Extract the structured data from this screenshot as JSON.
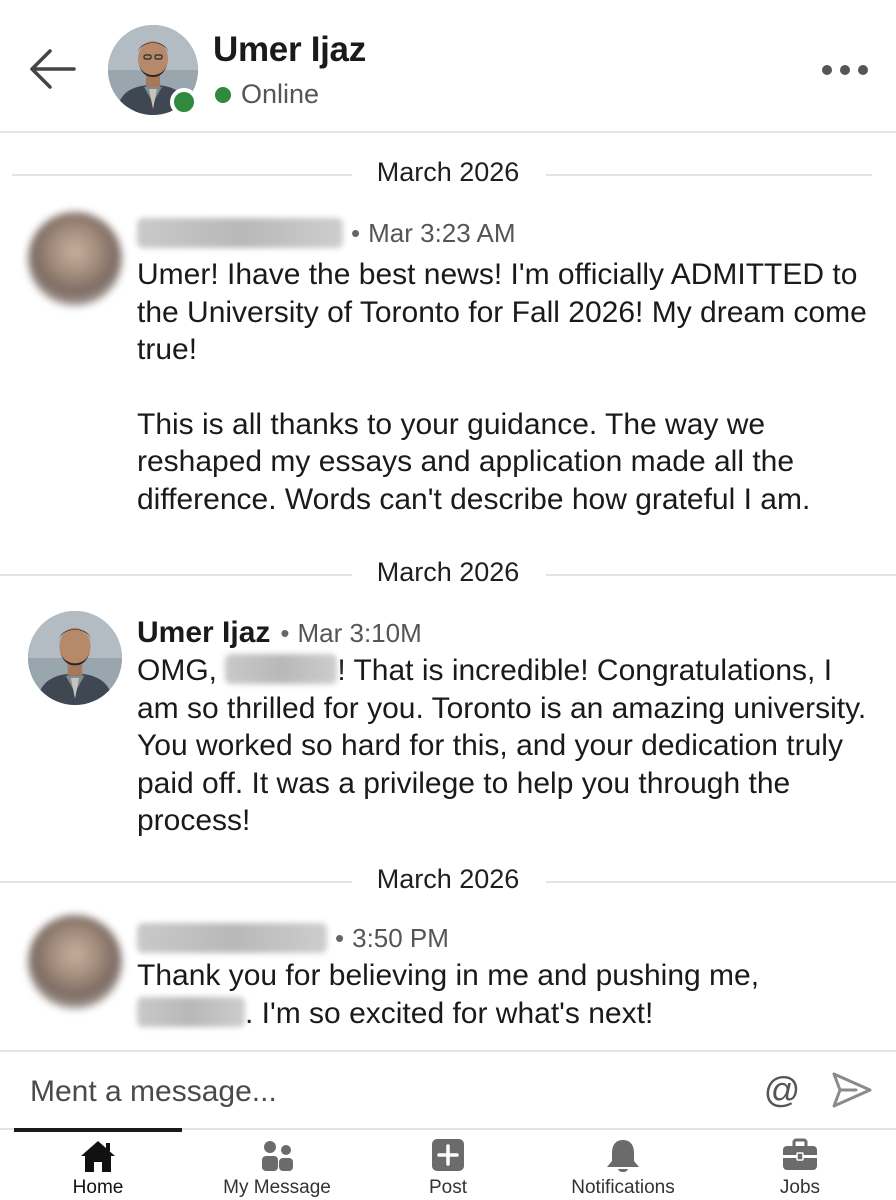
{
  "header": {
    "contact_name": "Umer Ijaz",
    "status": "Online",
    "back_icon": "arrow-left-icon",
    "more_icon": "ellipsis-icon",
    "status_color": "#2f8a3e"
  },
  "conversation": [
    {
      "date_divider": "March 2026",
      "sender": "",
      "sender_blurred": true,
      "timestamp": "Mar 3:23 AM",
      "paragraphs": [
        "Umer! Ihave the best news! I'm officially ADMITTED to the University of Toronto for Fall 2026! My dream come true!",
        "This is all thanks to your guidance. The way we reshaped my essays and application made all the difference. Words can't describe how grateful I am."
      ]
    },
    {
      "date_divider": "March 2026",
      "sender": "Umer Ijaz",
      "sender_blurred": false,
      "timestamp": "Mar 3:10M",
      "text_before_blur": "OMG, ",
      "text_after_blur": "! That is incredible! Congratulations, I am so thrilled for you. Toronto is an amazing university. You worked so hard for this, and your dedication truly paid off. It was a privilege to help you through the process!"
    },
    {
      "date_divider": "March 2026",
      "sender": "",
      "sender_blurred": true,
      "timestamp": "3:50 PM",
      "text_before_blur": "Thank you for believing in me and pushing me,",
      "text_after_blur": ". I'm so excited for what's next!"
    }
  ],
  "composer": {
    "placeholder": "Ment a message...",
    "mention_symbol": "@",
    "send_icon": "send-icon"
  },
  "bottom_nav": {
    "items": [
      {
        "label": "Home",
        "icon": "home-icon",
        "active": true
      },
      {
        "label": "My Message",
        "icon": "people-icon",
        "active": false
      },
      {
        "label": "Post",
        "icon": "plus-square-icon",
        "active": false
      },
      {
        "label": "Notifications",
        "icon": "bell-icon",
        "active": false
      },
      {
        "label": "Jobs",
        "icon": "briefcase-icon",
        "active": false
      }
    ]
  }
}
